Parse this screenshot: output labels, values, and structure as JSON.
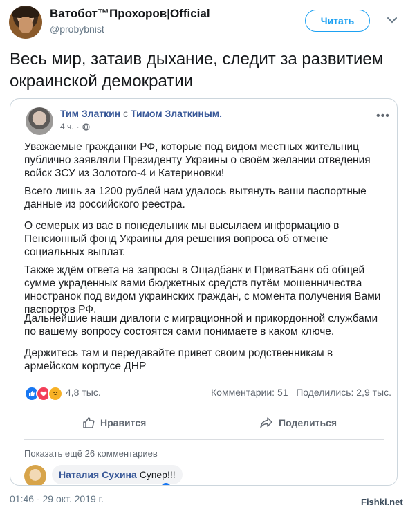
{
  "tweet": {
    "display_name": "Ватобот™Прохоров|Official",
    "handle": "@probybnist",
    "follow_label": "Читать",
    "text": "Весь мир, затаив дыхание, следит за развитием окраинской демократии",
    "timestamp": "01:46 - 29 окт. 2019 г."
  },
  "fb_post": {
    "author": "Тим Златкин",
    "with_word": "с",
    "with_person": "Тимом Златкиным.",
    "time": "4 ч.",
    "paragraphs": [
      "Уважаемые гражданки РФ, которые под видом местных жительниц публично заявляли Президенту Украины о своём желании отведения войск ЗСУ из Золотого-4 и Катериновки!",
      "Всего лишь за 1200 рублей нам удалось вытянуть ваши паспортные данные из российского реестра.",
      "О семерых из вас в понедельник мы высылаем информацию в Пенсионный фонд Украины для решения вопроса об отмене социальных выплат.",
      "Также ждём ответа на запросы в Ощадбанк и ПриватБанк об общей сумме украденных вами бюджетных средств путём мошенничества иностранок под видом украинских граждан, с момента получения Вами паспортов РФ.",
      "Дальнейшие наши диалоги с миграционной и прикордонной службами по вашему вопросу состоятся сами понимаете в каком ключе.",
      "Держитесь там и передавайте привет своим родственникам в армейском корпусе ДНР"
    ],
    "reactions_count": "4,8 тыс.",
    "comments_count": "Комментарии: 51",
    "shares_count": "Поделились: 2,9 тыс.",
    "like_label": "Нравится",
    "share_label": "Поделиться",
    "show_more": "Показать ещё 26 комментариев",
    "comment": {
      "author": "Наталия Сухина",
      "text": "Супер!!!"
    }
  },
  "watermark": "Fishki.net",
  "colors": {
    "twitter_blue": "#1da1f2",
    "fb_link": "#385898",
    "like_blue": "#1877f2",
    "love_red": "#f33e58",
    "haha_yellow": "#f7b125"
  }
}
